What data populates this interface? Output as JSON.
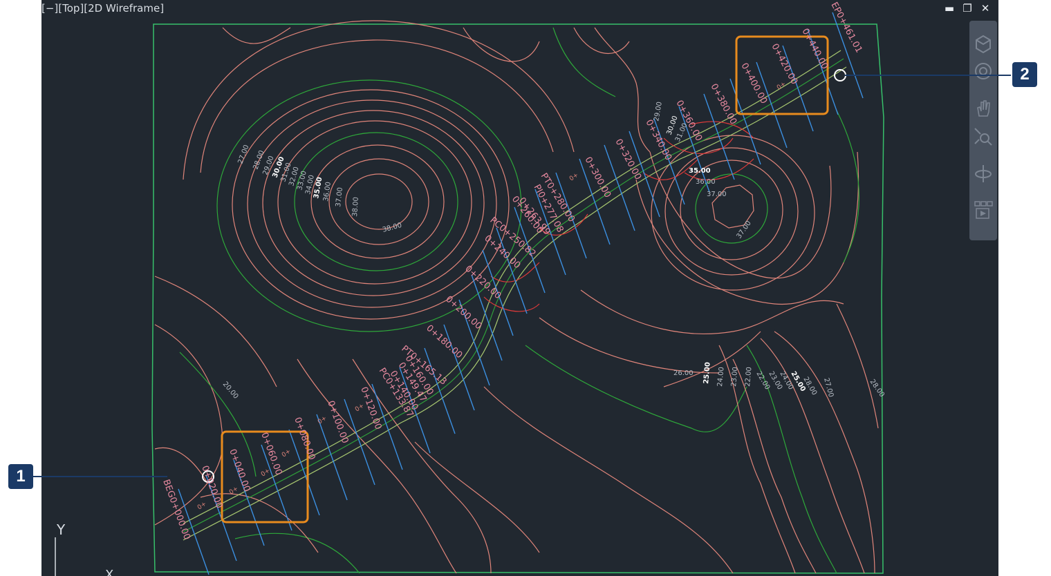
{
  "viewport": {
    "label": "[−][Top][2D Wireframe]",
    "controls": {
      "minimize": "▬",
      "restore": "❐",
      "close": "✕"
    }
  },
  "nav_bar": {
    "icons": [
      "view-cube-icon",
      "steering-wheel-icon",
      "pan-icon",
      "zoom-extents-icon",
      "orbit-icon",
      "showmotion-icon"
    ]
  },
  "ucs": {
    "y_label": "Y",
    "x_label": "X"
  },
  "callouts": {
    "one": "1",
    "two": "2"
  },
  "colors": {
    "contour_minor": "#e0857a",
    "contour_major": "#2ea83a",
    "boundary": "#37c06a",
    "alignment": "#2f9e3a",
    "sample_line": "#3b8fe0",
    "highlight": "#e88b1e",
    "callout_bg": "#1b3a66",
    "grade_lines": "#e03a3a"
  },
  "contour_labels": {
    "left_hill": [
      "27.00",
      "28.00",
      "29.00",
      "30.00",
      "31.00",
      "32.00",
      "33.00",
      "34.00",
      "35.00",
      "36.00",
      "37.00",
      "38.00"
    ],
    "top": "38.00",
    "right_hill_top": "37.00",
    "right_hill": "37.00",
    "mid": [
      "35.00",
      "36.00"
    ],
    "lower_left": "20.00",
    "bottom_right": [
      "26.00",
      "25.00",
      "24.00",
      "23.00",
      "22.00",
      "22.00",
      "23.00",
      "24.00",
      "25.00",
      "28.00",
      "27.00",
      "28.00"
    ],
    "near_alignment": [
      "29.00",
      "30.00",
      "31.00"
    ]
  },
  "stations": [
    "BEG0+000.00",
    "0+020.00",
    "0+040.00",
    "0+060.00",
    "0+080.00",
    "0+100.00",
    "0+120.00",
    "PC0+133.87",
    "0+140.00",
    "0+149.47",
    "0+160.00",
    "PT0+165.13",
    "0+180.00",
    "0+200.00",
    "0+220.00",
    "0+240.00",
    "PC0+250.82",
    "0+260.00",
    "0+263.99",
    "PI0+277.08",
    "PT0+280.00",
    "0+300.00",
    "0+320.00",
    "0+340.00",
    "0+360.00",
    "0+380.00",
    "0+400.00",
    "0+420.00",
    "0+440.00",
    "EP0+461.01"
  ],
  "station_marks": [
    "0+",
    "0+",
    "0+",
    "0+",
    "0+",
    "0+",
    "0+",
    "0+"
  ]
}
